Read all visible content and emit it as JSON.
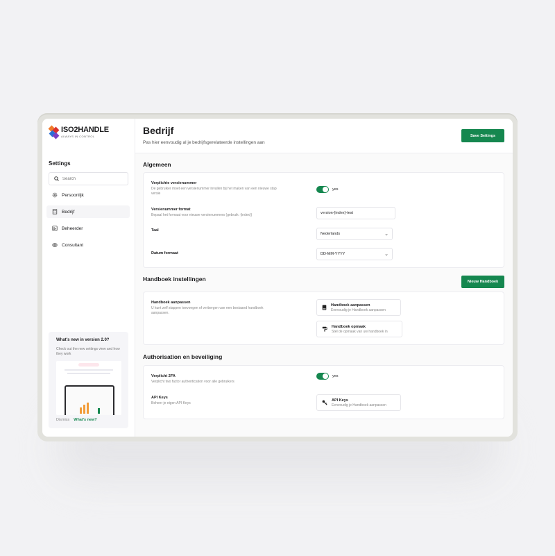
{
  "brand": {
    "name": "ISO2HANDLE",
    "tagline": "ALWAYS IN CONTROL",
    "accent": "#15874f"
  },
  "sidebar": {
    "title": "Settings",
    "search_placeholder": "Search",
    "items": [
      {
        "label": "Persoonlijk",
        "icon": "gear-icon"
      },
      {
        "label": "Bedrijf",
        "icon": "building-icon",
        "active": true
      },
      {
        "label": "Beheerder",
        "icon": "admin-icon"
      },
      {
        "label": "Consultant",
        "icon": "handshake-icon"
      }
    ],
    "whatsnew": {
      "title": "What's new in version 2.0?",
      "text": "Check out the new settings view and how they work",
      "dismiss": "Dismiss",
      "link": "What's new?"
    }
  },
  "header": {
    "title": "Bedrijf",
    "subtitle": "Pas hier eenvoudig al je bedrijfsgerelateerde instellingen aan",
    "save_label": "Save Settings"
  },
  "algemeen": {
    "title": "Algemeen",
    "verplichte": {
      "label": "Verplichte versienummer",
      "desc": "De gebruiker moet een versienummer invullen bij het maken van een nieuwe stap versie",
      "toggle_label": "yes"
    },
    "format": {
      "label": "Versienummer format",
      "desc": "Bepaal het formaat voor nieuwe versienummers (gebruik: {index})",
      "value": "version-{index}-test"
    },
    "taal": {
      "label": "Taal",
      "value": "Nederlands"
    },
    "datum": {
      "label": "Datum formaat",
      "value": "DD-MM-YYYY"
    }
  },
  "handboek": {
    "title": "Handboek instellingen",
    "new_label": "Nieuw Handboek",
    "label": "Handboek aanpassen",
    "desc": "U kunt zelf stappen toevoegen of verbergen van een bestaand handboek aanpassen.",
    "cards": [
      {
        "title": "Handboek aanpassen",
        "sub": "Eenvoudig je Handboek aanpassen",
        "icon": "book-icon"
      },
      {
        "title": "Handboek opmaak",
        "sub": "Stel de opmaak van uw handboek in",
        "icon": "paint-roller-icon"
      }
    ]
  },
  "auth": {
    "title": "Authorisation en beveiliging",
    "twofa": {
      "label": "Verplicht 2FA",
      "desc": "Verplicht two factor authentication voor alle gebruikers",
      "toggle_label": "yes"
    },
    "api": {
      "label": "API Keys",
      "desc": "Beheer je eigen API Keys",
      "card_title": "API Keys",
      "card_sub": "Eenvoudig je Handboek aanpassen",
      "icon": "key-icon"
    }
  }
}
